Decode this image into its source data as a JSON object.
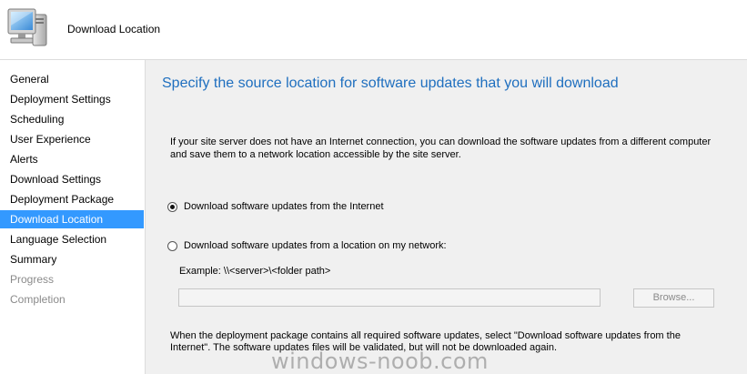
{
  "header": {
    "title": "Download Location",
    "icon": "computer-monitor-icon"
  },
  "sidebar": {
    "items": [
      {
        "label": "General",
        "state": "normal"
      },
      {
        "label": "Deployment Settings",
        "state": "normal"
      },
      {
        "label": "Scheduling",
        "state": "normal"
      },
      {
        "label": "User Experience",
        "state": "normal"
      },
      {
        "label": "Alerts",
        "state": "normal"
      },
      {
        "label": "Download Settings",
        "state": "normal"
      },
      {
        "label": "Deployment Package",
        "state": "normal"
      },
      {
        "label": "Download Location",
        "state": "active"
      },
      {
        "label": "Language Selection",
        "state": "normal"
      },
      {
        "label": "Summary",
        "state": "normal"
      },
      {
        "label": "Progress",
        "state": "disabled"
      },
      {
        "label": "Completion",
        "state": "disabled"
      }
    ]
  },
  "main": {
    "heading": "Specify the source location for software updates that you will download",
    "description": "If your site server does not have an Internet connection, you can download the software updates from a different computer and save them to a network location accessible by the site server.",
    "options": [
      {
        "label": "Download software updates from the Internet",
        "checked": true
      },
      {
        "label": "Download software updates from a location on my network:",
        "checked": false
      }
    ],
    "example_label": "Example: \\\\<server>\\<folder path>",
    "path_input": {
      "value": "",
      "placeholder": ""
    },
    "browse_label": "Browse...",
    "note": "When the deployment package contains all required software updates, select \"Download  software updates from the Internet\". The software updates files will be validated, but will not be downloaded again."
  },
  "watermark": "windows-noob.com",
  "colors": {
    "accent": "#3399ff",
    "heading": "#1f6fbf",
    "panel_bg": "#f0f0f0",
    "disabled_text": "#8a8a8a"
  }
}
